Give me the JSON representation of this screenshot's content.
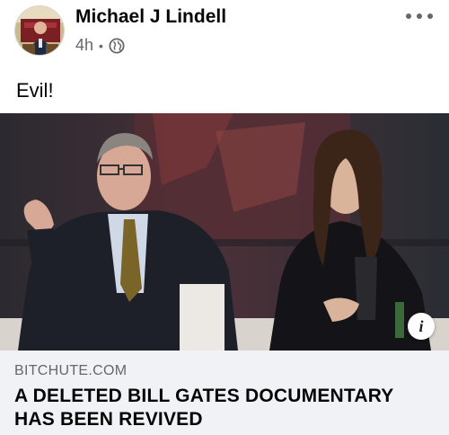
{
  "post": {
    "author_name": "Michael J Lindell",
    "time_ago": "4h",
    "separator": "•",
    "audience_icon": "globe-icon",
    "more_icon": "more-options-icon",
    "text": "Evil!"
  },
  "link_preview": {
    "domain": "BITCHUTE.COM",
    "headline": "A DELETED BILL GATES DOCUMENTARY HAS BEEN REVIVED",
    "info_icon": "info-icon",
    "info_glyph": "i"
  },
  "colors": {
    "text_primary": "#050505",
    "text_secondary": "#65676b",
    "link_box_bg": "#f0f2f5"
  }
}
